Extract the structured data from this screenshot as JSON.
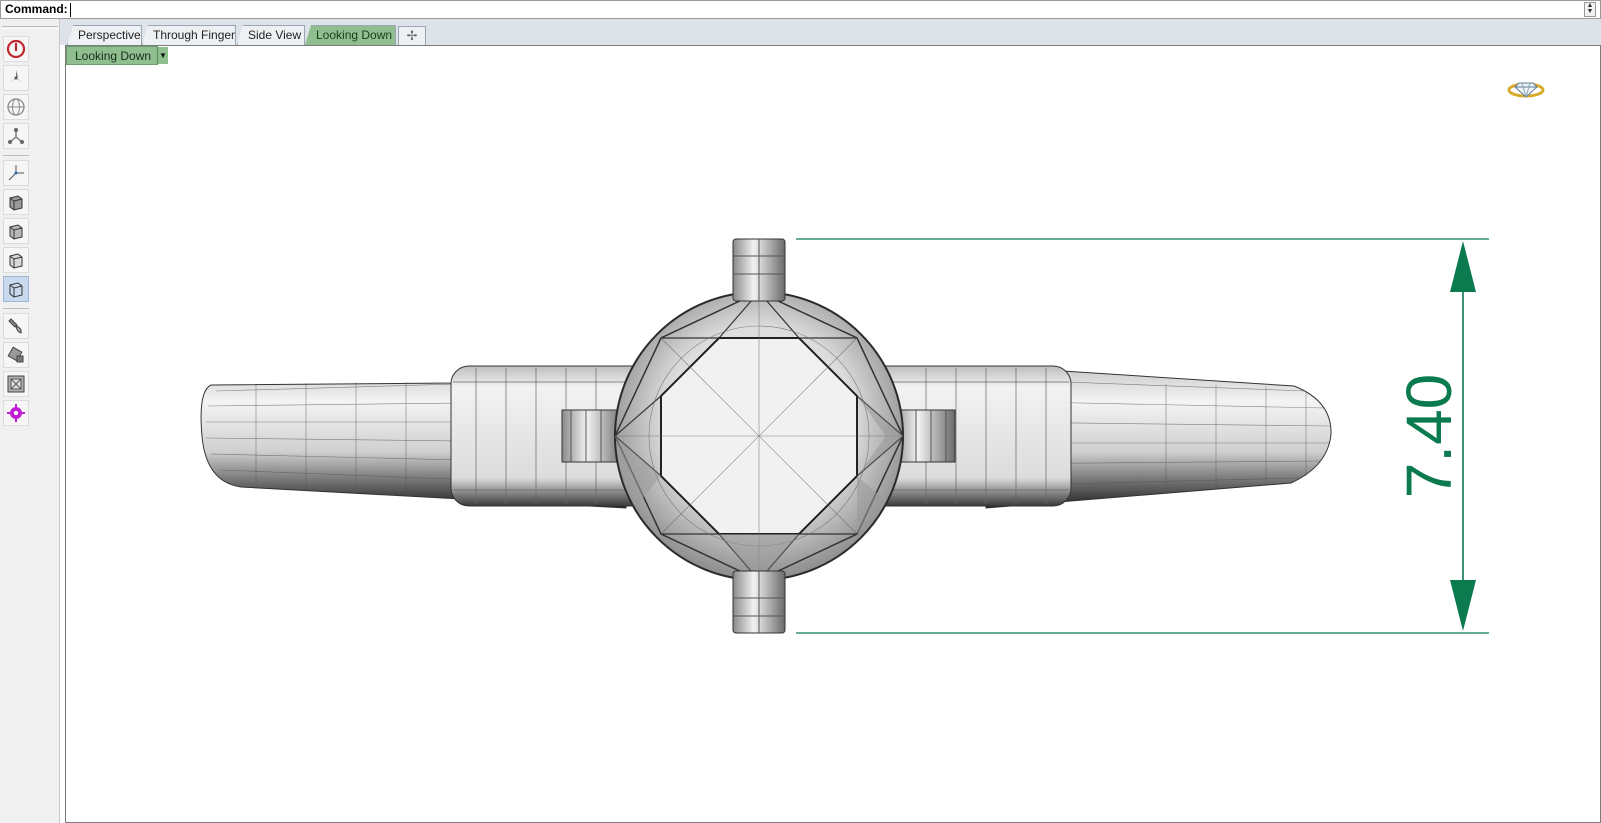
{
  "command": {
    "label": "Command:",
    "value": ""
  },
  "toolbar": {
    "tools": [
      {
        "name": "power-icon"
      },
      {
        "name": "propeller-icon"
      },
      {
        "name": "globe-icon"
      },
      {
        "name": "network-nodes-icon"
      },
      {
        "name": "axis-tripod-icon"
      },
      {
        "name": "cube-shaded-icon"
      },
      {
        "name": "cube-rendered-icon"
      },
      {
        "name": "cube-ghosted-icon"
      },
      {
        "name": "cube-wireframe-icon"
      },
      {
        "name": "brush-icon"
      },
      {
        "name": "paint-bucket-icon"
      },
      {
        "name": "render-frame-icon"
      },
      {
        "name": "magenta-gear-icon"
      }
    ],
    "active_index": 8
  },
  "tabs": [
    {
      "label": "Perspective",
      "active": false
    },
    {
      "label": "Through Finger",
      "active": false
    },
    {
      "label": "Side View",
      "active": false
    },
    {
      "label": "Looking Down",
      "active": true
    }
  ],
  "tab_add_icon": "plus-icon",
  "viewport": {
    "title": "Looking Down",
    "dimension_value": "7.40",
    "dimension_color": "#0b7a4f",
    "corner_icon": "diamond-ring-icon"
  },
  "colors": {
    "active_tab": "#8fbf8f",
    "dimension": "#0b7a4f"
  }
}
